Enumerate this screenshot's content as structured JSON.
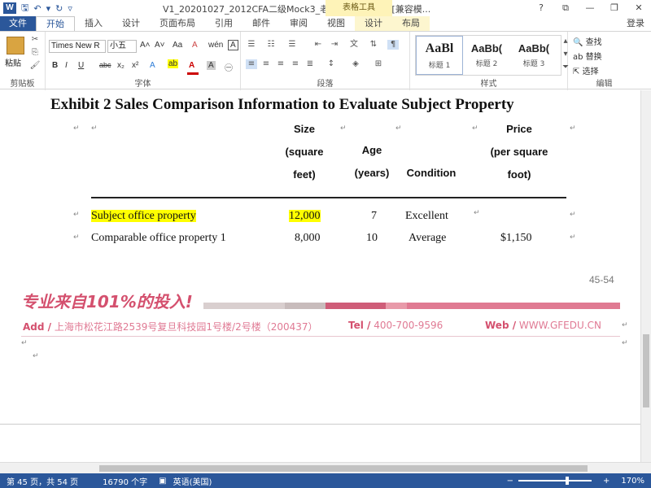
{
  "window": {
    "title": "V1_20201027_2012CFA二级Mock3_老师授课版.docx [兼容模...",
    "context_tool_header": "表格工具",
    "login": "登录",
    "help": "?",
    "controls": {
      "restore": "⧉",
      "minimize": "—",
      "maximize": "❐",
      "close": "✕"
    }
  },
  "tabs": [
    {
      "label": "文件"
    },
    {
      "label": "开始"
    },
    {
      "label": "插入"
    },
    {
      "label": "设计"
    },
    {
      "label": "页面布局"
    },
    {
      "label": "引用"
    },
    {
      "label": "邮件"
    },
    {
      "label": "审阅"
    },
    {
      "label": "视图"
    },
    {
      "label": "设计"
    },
    {
      "label": "布局"
    }
  ],
  "ribbon": {
    "clipboard": {
      "paste": "粘贴",
      "group": "剪贴板"
    },
    "font": {
      "name": "Times New R",
      "size": "小五",
      "group": "字体",
      "aa": "Aa",
      "grow": "A˄",
      "shrink": "A˅",
      "clear": "A",
      "bold": "B",
      "italic": "I",
      "underline": "U",
      "strike": "abc",
      "sub": "x₂",
      "sup": "x²",
      "effects": "A",
      "highlight": "ab",
      "fontcolor": "A",
      "shade": "A",
      "charborder": "A",
      "pinyin": "wén",
      "encircle": "㊀"
    },
    "paragraph": {
      "group": "段落"
    },
    "styles": {
      "group": "样式",
      "items": [
        {
          "preview": "AaBl",
          "name": "标题 1"
        },
        {
          "preview": "AaBb(",
          "name": "标题 2"
        },
        {
          "preview": "AaBb(",
          "name": "标题 3"
        }
      ]
    },
    "editing": {
      "group": "编辑",
      "find": "查找",
      "replace": "替换",
      "select": "选择"
    }
  },
  "document": {
    "exhibit_title": "Exhibit 2      Sales Comparison Information to Evaluate Subject Property",
    "headers": {
      "size": [
        "Size",
        "(square",
        "feet)"
      ],
      "age": [
        "Age",
        "(years)"
      ],
      "condition": "Condition",
      "price": [
        "Price",
        "(per square",
        "foot)"
      ]
    },
    "rows": [
      {
        "property": "Subject office property",
        "size": "12,000",
        "age": "7",
        "condition": "Excellent",
        "price": ""
      },
      {
        "property": "Comparable office property 1",
        "size": "8,000",
        "age": "10",
        "condition": "Average",
        "price": "$1,150"
      }
    ],
    "page_number": "45-54",
    "footer": {
      "slogan": "专业来自101%的投入!",
      "address_label": "Add /",
      "address": " 上海市松花江路2539号复旦科技园1号楼/2号楼（200437）",
      "tel_label": "Tel /",
      "tel": " 400-700-9596",
      "web_label": "Web /",
      "web": " WWW.GFEDU.CN"
    },
    "marks": {
      "cell": "↵",
      "para": "↵"
    },
    "colors": {
      "highlight": "#ffff00",
      "brand_pink": "#d4506e",
      "word_blue": "#2b579a"
    }
  },
  "status_bar": {
    "page": "第 45 页，共 54 页",
    "words": "16790 个字",
    "language": "英语(美国)",
    "zoom": "170%",
    "zoom_minus": "−",
    "zoom_plus": "+"
  }
}
